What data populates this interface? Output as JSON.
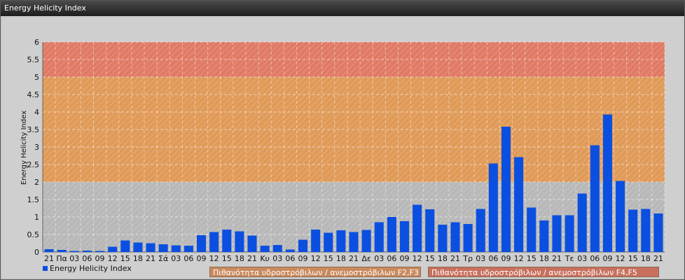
{
  "window": {
    "title": "Energy Helicity Index"
  },
  "legend": {
    "series": "Energy Helicity Index",
    "band1": "Πιθανότητα υδροστρόβιλων / ανεμοστρόβιλων F2,F3",
    "band2": "Πιθανότητα υδροστρόβιλων / ανεμοστρόβιλων F4,F5"
  },
  "colors": {
    "bar": "#0b4fe0",
    "band_low": "#b8b8b8",
    "band_mid": "#e09a58",
    "band_high": "#e07a65"
  },
  "chart_data": {
    "type": "bar",
    "ylabel": "Energy Helicity Index",
    "ylim": [
      0,
      6
    ],
    "yticks": [
      "0",
      "0.5",
      "1",
      "1.5",
      "2",
      "2.5",
      "3",
      "3.5",
      "4",
      "4.5",
      "5",
      "5.5",
      "6"
    ],
    "bands": [
      {
        "from": 0,
        "to": 2
      },
      {
        "from": 2,
        "to": 5
      },
      {
        "from": 5,
        "to": 6
      }
    ],
    "categories": [
      "21",
      "Πα",
      "03",
      "06",
      "09",
      "12",
      "15",
      "18",
      "21",
      "Σά",
      "03",
      "06",
      "09",
      "12",
      "15",
      "18",
      "21",
      "Κυ",
      "03",
      "06",
      "09",
      "12",
      "15",
      "18",
      "21",
      "Δε",
      "03",
      "06",
      "09",
      "12",
      "15",
      "18",
      "21",
      "Τρ",
      "03",
      "06",
      "09",
      "12",
      "15",
      "18",
      "21",
      "Τε",
      "03",
      "06",
      "09",
      "12",
      "15",
      "18",
      "21"
    ],
    "values": [
      0.08,
      0.06,
      0.03,
      0.04,
      0.03,
      0.15,
      0.33,
      0.27,
      0.25,
      0.22,
      0.19,
      0.18,
      0.48,
      0.57,
      0.64,
      0.59,
      0.47,
      0.18,
      0.2,
      0.07,
      0.35,
      0.64,
      0.55,
      0.62,
      0.57,
      0.63,
      0.85,
      1.0,
      0.88,
      1.35,
      1.22,
      0.78,
      0.85,
      0.8,
      1.23,
      2.53,
      3.58,
      2.71,
      1.27,
      0.9,
      1.05,
      1.05,
      1.67,
      3.05,
      3.93,
      2.03,
      1.21,
      1.23,
      1.1
    ],
    "grid": true
  }
}
